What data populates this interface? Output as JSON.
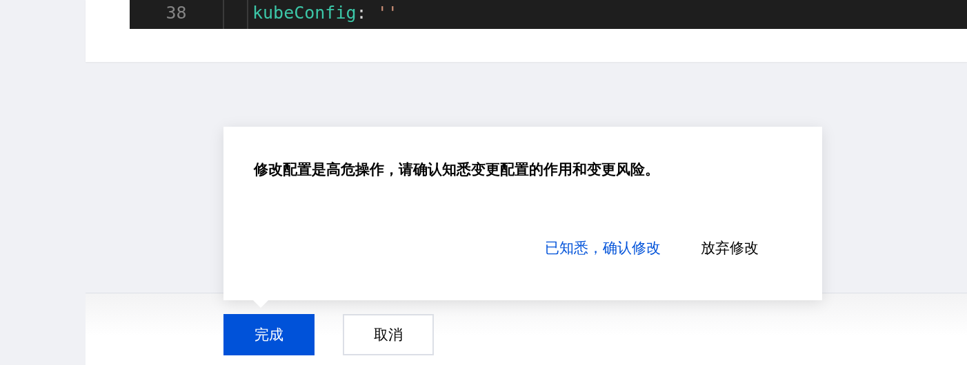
{
  "editor": {
    "lines": [
      {
        "number": "38",
        "key": "kubeConfig",
        "colon": ":",
        "value": "''"
      }
    ]
  },
  "popconfirm": {
    "message": "修改配置是高危操作，请确认知悉变更配置的作用和变更风险。",
    "confirm": "已知悉，确认修改",
    "cancel": "放弃修改"
  },
  "footer": {
    "buttons": [
      {
        "label": "完成",
        "kind": "primary"
      },
      {
        "label": "取消",
        "kind": "default"
      }
    ]
  }
}
